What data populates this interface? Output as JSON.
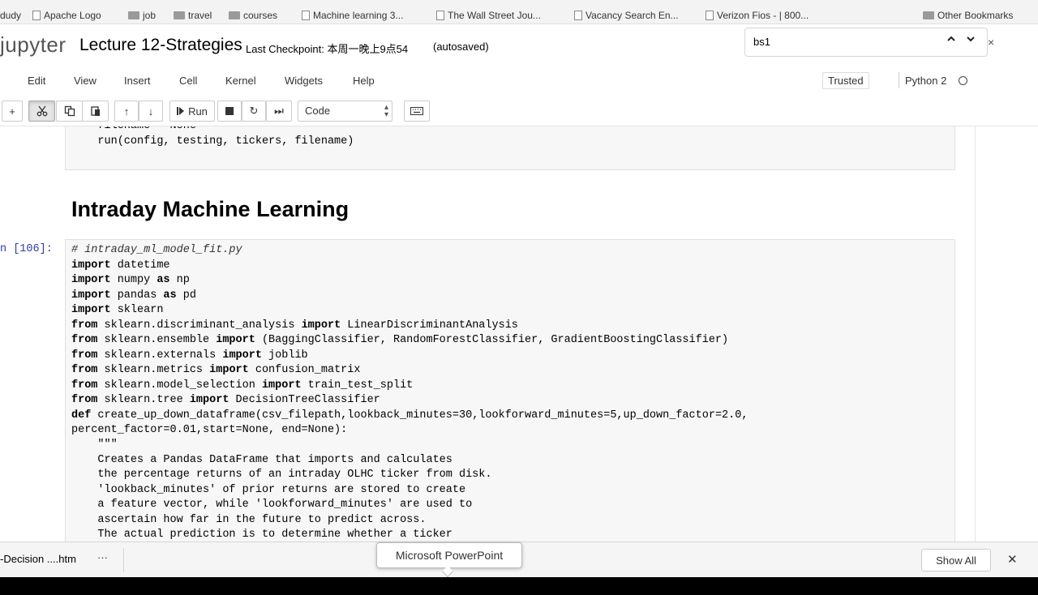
{
  "bookmarks": [
    {
      "label": "dudy",
      "icon": "none"
    },
    {
      "label": "Apache Logo",
      "icon": "page-icon"
    },
    {
      "label": "job",
      "icon": "folder-icon"
    },
    {
      "label": "travel",
      "icon": "folder-icon"
    },
    {
      "label": "courses",
      "icon": "folder-icon"
    },
    {
      "label": "Machine learning 3...",
      "icon": "page-icon"
    },
    {
      "label": "The Wall Street Jou...",
      "icon": "page-icon"
    },
    {
      "label": "Vacancy Search En...",
      "icon": "page-icon"
    },
    {
      "label": "Verizon Fios - | 800...",
      "icon": "page-icon"
    },
    {
      "label": "Other Bookmarks",
      "icon": "folder-icon"
    }
  ],
  "header": {
    "logo": "jupyter",
    "title": "Lecture 12-Strategies",
    "checkpoint": "Last Checkpoint: 本周一晚上9点54",
    "autosave": "(autosaved)"
  },
  "find": {
    "query": "bs1",
    "prev_icon": "chevron-up-icon",
    "next_icon": "chevron-down-icon",
    "close": "×"
  },
  "menu": [
    "Edit",
    "View",
    "Insert",
    "Cell",
    "Kernel",
    "Widgets",
    "Help"
  ],
  "status": {
    "trusted": "Trusted",
    "kernel": "Python 2"
  },
  "toolbar": {
    "add": "+",
    "move_up": "↑",
    "move_down": "↓",
    "run": "Run",
    "restart": "↻",
    "run_all": "⏭",
    "cell_type": "Code"
  },
  "prev_cell": {
    "lines": [
      "    filename = None",
      "    run(config, testing, tickers, filename)"
    ]
  },
  "heading": "Intraday Machine Learning",
  "prompt": "n [106]:",
  "code": {
    "comment": "# intraday_ml_model_fit.py",
    "lines": [
      [
        {
          "t": "import",
          "k": 1
        },
        {
          "t": " datetime"
        }
      ],
      [
        {
          "t": "import",
          "k": 1
        },
        {
          "t": " numpy "
        },
        {
          "t": "as",
          "k": 1
        },
        {
          "t": " np"
        }
      ],
      [
        {
          "t": "import",
          "k": 1
        },
        {
          "t": " pandas "
        },
        {
          "t": "as",
          "k": 1
        },
        {
          "t": " pd"
        }
      ],
      [
        {
          "t": "import",
          "k": 1
        },
        {
          "t": " sklearn"
        }
      ],
      [
        {
          "t": "from",
          "k": 1
        },
        {
          "t": " sklearn.discriminant_analysis "
        },
        {
          "t": "import",
          "k": 1
        },
        {
          "t": " LinearDiscriminantAnalysis"
        }
      ],
      [
        {
          "t": "from",
          "k": 1
        },
        {
          "t": " sklearn.ensemble "
        },
        {
          "t": "import",
          "k": 1
        },
        {
          "t": " (BaggingClassifier, RandomForestClassifier, GradientBoostingClassifier)"
        }
      ],
      [
        {
          "t": "from",
          "k": 1
        },
        {
          "t": " sklearn.externals "
        },
        {
          "t": "import",
          "k": 1
        },
        {
          "t": " joblib"
        }
      ],
      [
        {
          "t": "from",
          "k": 1
        },
        {
          "t": " sklearn.metrics "
        },
        {
          "t": "import",
          "k": 1
        },
        {
          "t": " confusion_matrix"
        }
      ],
      [
        {
          "t": "from",
          "k": 1
        },
        {
          "t": " sklearn.model_selection "
        },
        {
          "t": "import",
          "k": 1
        },
        {
          "t": " train_test_split"
        }
      ],
      [
        {
          "t": "from",
          "k": 1
        },
        {
          "t": " sklearn.tree "
        },
        {
          "t": "import",
          "k": 1
        },
        {
          "t": " DecisionTreeClassifier"
        }
      ],
      [
        {
          "t": "def",
          "k": 1
        },
        {
          "t": " create_up_down_dataframe(csv_filepath,lookback_minutes=30,lookforward_minutes=5,up_down_factor=2.0,"
        }
      ],
      [
        {
          "t": "percent_factor=0.01,start=None, end=None):"
        }
      ],
      [
        {
          "t": "    \"\"\""
        }
      ],
      [
        {
          "t": "    Creates a Pandas DataFrame that imports and calculates"
        }
      ],
      [
        {
          "t": "    the percentage returns of an intraday OLHC ticker from disk."
        }
      ],
      [
        {
          "t": "    'lookback_minutes' of prior returns are stored to create"
        }
      ],
      [
        {
          "t": "    a feature vector, while 'lookforward_minutes' are used to"
        }
      ],
      [
        {
          "t": "    ascertain how far in the future to predict across."
        }
      ],
      [
        {
          "t": "    The actual prediction is to determine whether a ticker"
        }
      ]
    ]
  },
  "downloads": {
    "file": "-Decision ....htm",
    "more": "···",
    "tooltip": "Microsoft PowerPoint",
    "show_all": "Show All",
    "close": "✕"
  }
}
